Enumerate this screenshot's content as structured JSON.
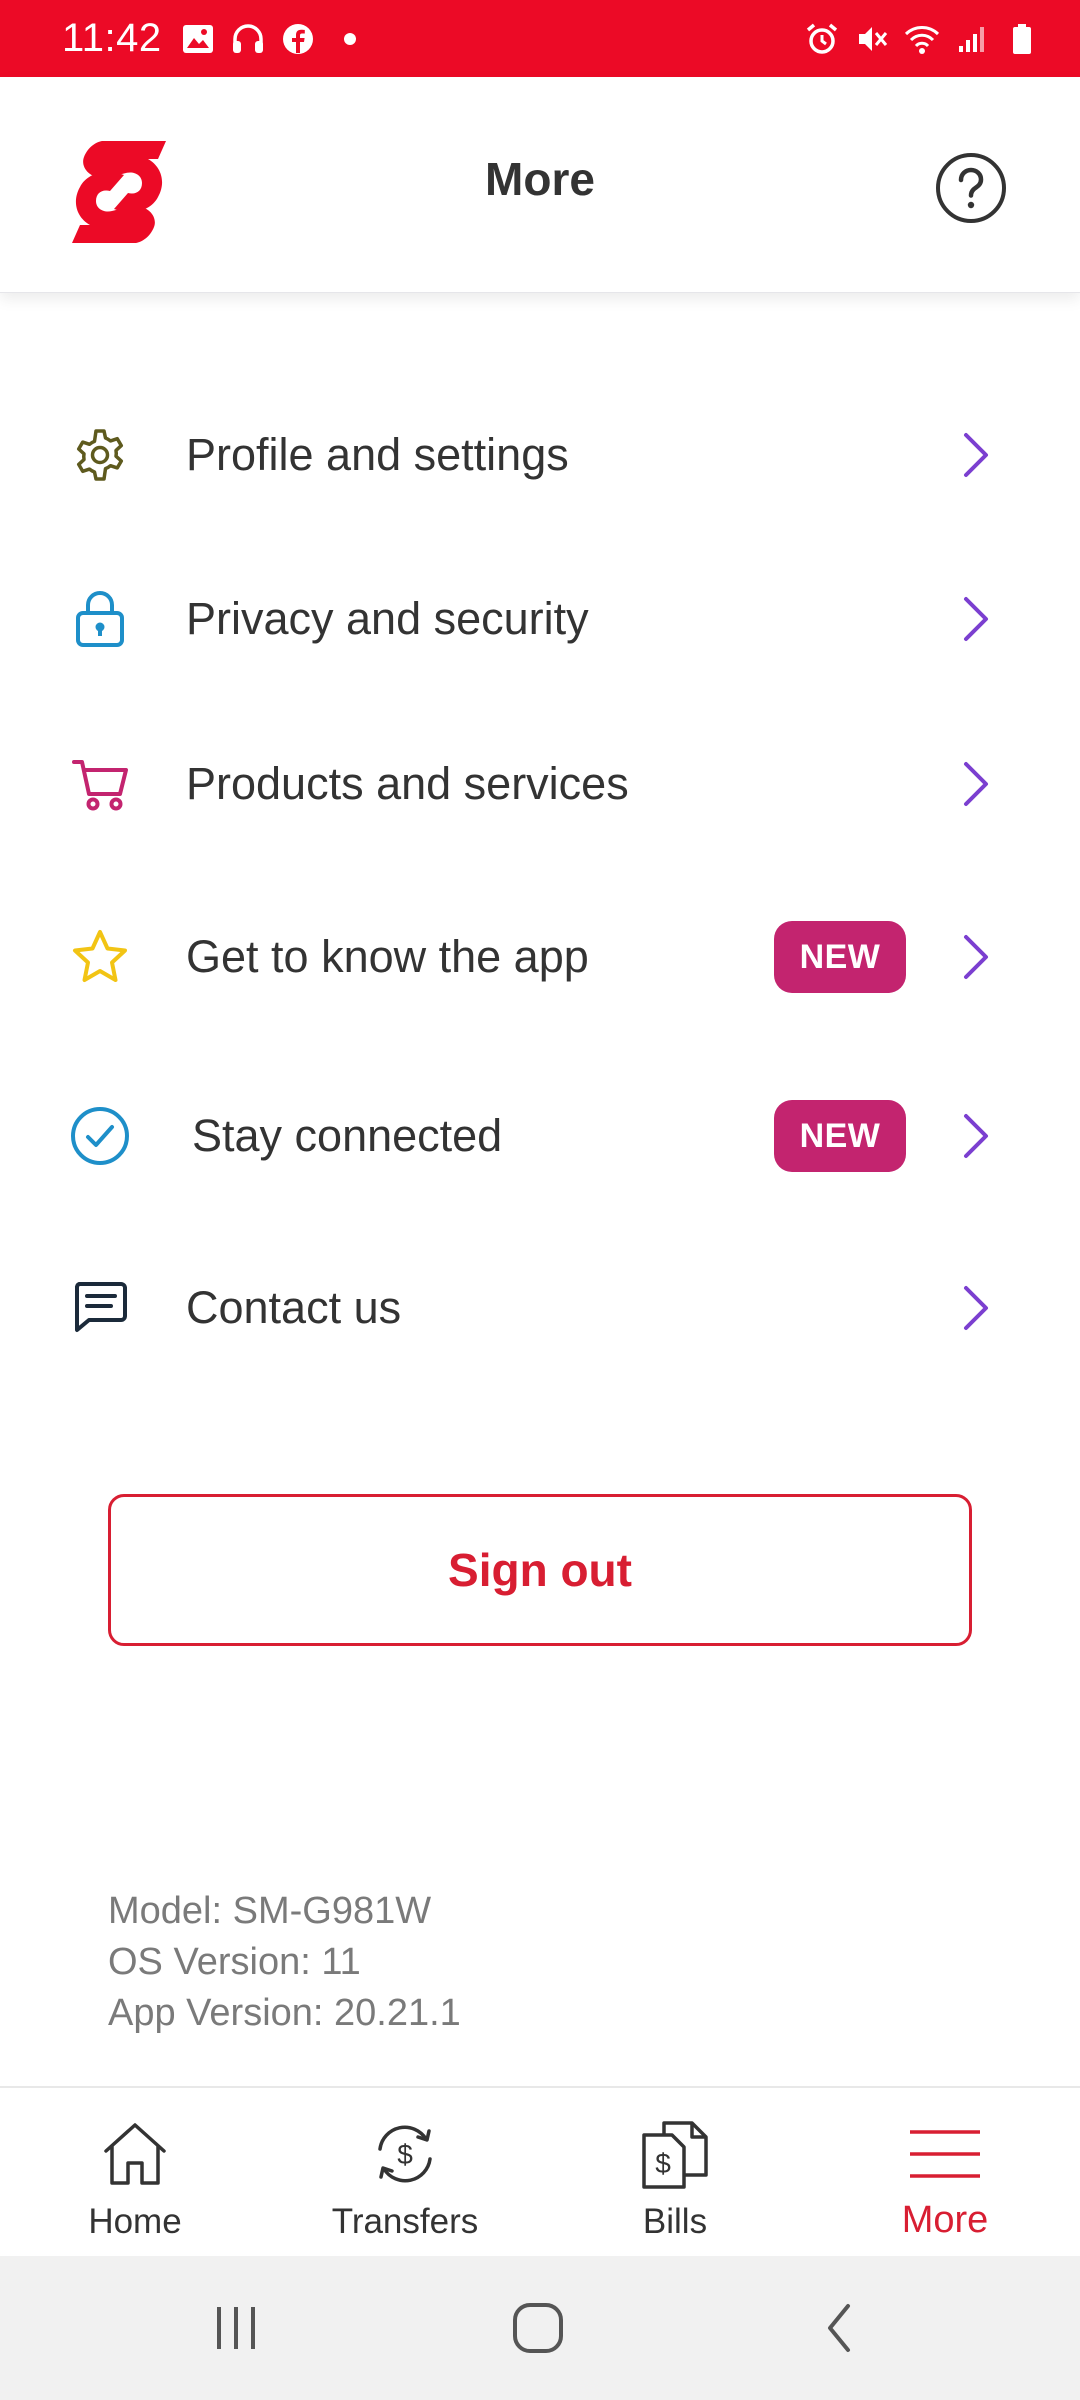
{
  "status_bar": {
    "time": "11:42",
    "left_icons": [
      "image-icon",
      "headphones-icon",
      "facebook-icon",
      "dot-icon"
    ],
    "right_icons": [
      "alarm-icon",
      "mute-icon",
      "wifi-icon",
      "signal-icon",
      "battery-icon"
    ],
    "color": "#EC0A26"
  },
  "header": {
    "title": "More",
    "logo": "scotiabank-logo",
    "help_icon": "help-icon"
  },
  "menu": {
    "items": [
      {
        "label": "Profile and settings",
        "icon": "gear-icon",
        "badge": ""
      },
      {
        "label": "Privacy and security",
        "icon": "lock-icon",
        "badge": ""
      },
      {
        "label": "Products and services",
        "icon": "cart-icon",
        "badge": ""
      },
      {
        "label": "Get to know the app",
        "icon": "star-icon",
        "badge": "NEW"
      },
      {
        "label": "Stay connected",
        "icon": "check-circle-icon",
        "badge": "NEW"
      },
      {
        "label": "Contact us",
        "icon": "chat-icon",
        "badge": ""
      }
    ]
  },
  "signout": {
    "label": "Sign out"
  },
  "device_info": {
    "model": "Model: SM-G981W",
    "os_version": "OS Version: 11",
    "app_version": "App Version: 20.21.1"
  },
  "bottom_nav": {
    "items": [
      {
        "label": "Home",
        "icon": "home-icon",
        "active": false
      },
      {
        "label": "Transfers",
        "icon": "transfers-icon",
        "active": false
      },
      {
        "label": "Bills",
        "icon": "bills-icon",
        "active": false
      },
      {
        "label": "More",
        "icon": "menu-icon",
        "active": true
      }
    ]
  },
  "system_nav": [
    "recents-icon",
    "home-circle-icon",
    "back-icon"
  ],
  "colors": {
    "brand_red": "#EC0A26",
    "signout_red": "#D81E32",
    "badge_magenta": "#C3246F",
    "chevron_purple": "#7B3FD0"
  }
}
